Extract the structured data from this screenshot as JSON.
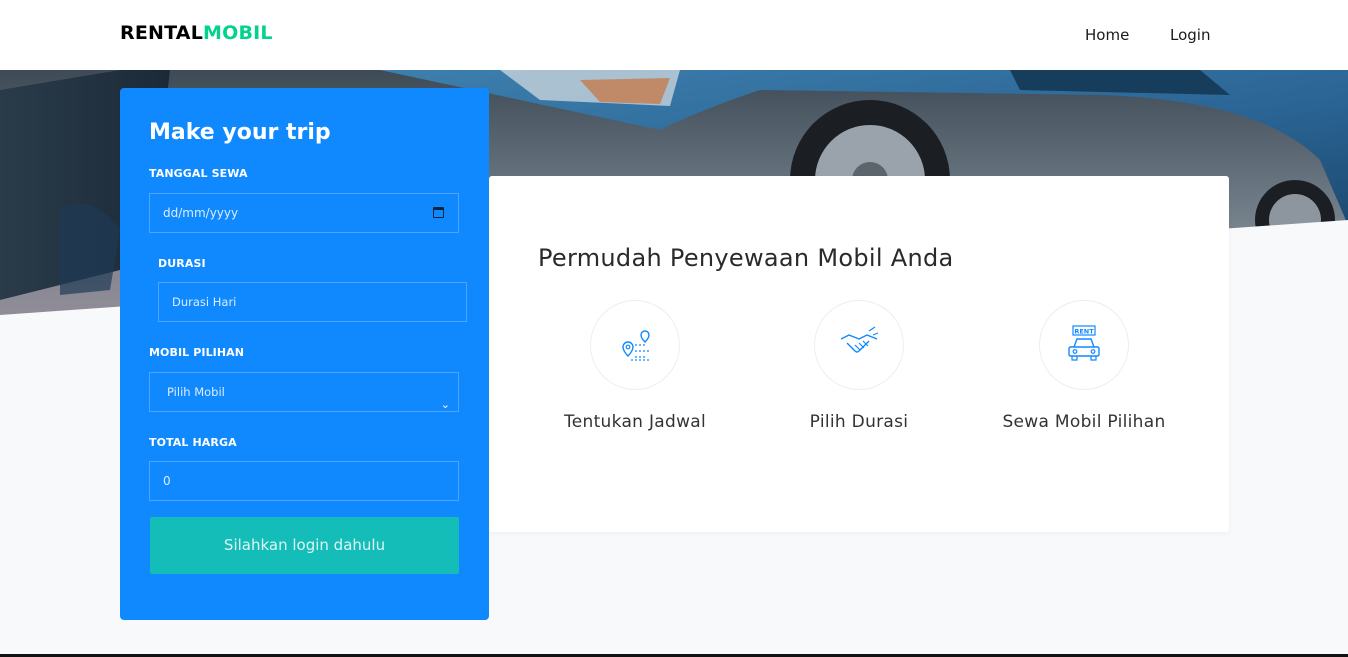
{
  "navbar": {
    "brand_part1": "RENTAL",
    "brand_part2": "MOBIL",
    "links": [
      "Home",
      "Login"
    ]
  },
  "trip_form": {
    "title": "Make your trip",
    "date_label": "TANGGAL SEWA",
    "date_placeholder": "dd/mm/yyyy",
    "duration_label": "DURASI",
    "duration_placeholder": "Durasi Hari",
    "car_label": "MOBIL PILIHAN",
    "car_selected": "Pilih Mobil",
    "total_label": "TOTAL HARGA",
    "total_value": "0",
    "submit_label": "Silahkan login dahulu"
  },
  "info": {
    "title": "Permudah Penyewaan Mobil Anda",
    "features": [
      {
        "label": "Tentukan Jadwal",
        "icon": "route-map-icon"
      },
      {
        "label": "Pilih Durasi",
        "icon": "handshake-icon"
      },
      {
        "label": "Sewa Mobil Pilihan",
        "icon": "rent-car-icon"
      }
    ]
  },
  "colors": {
    "brand_accent": "#01d28e",
    "form_bg": "#1089ff",
    "button_bg": "#14bdb8"
  }
}
